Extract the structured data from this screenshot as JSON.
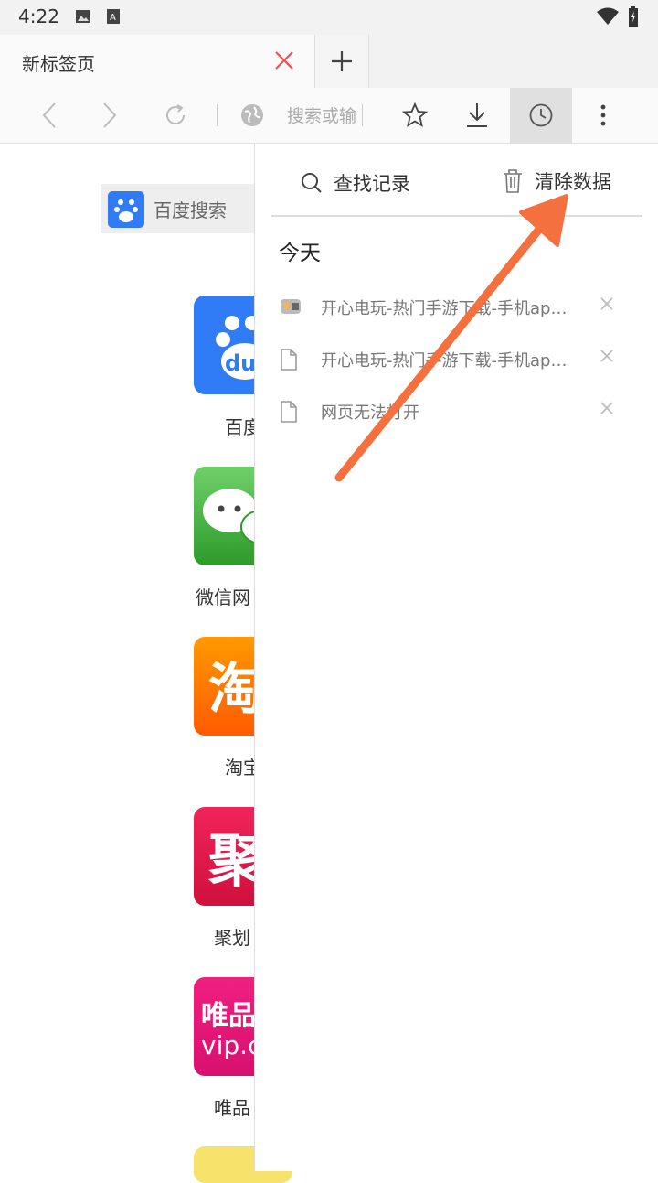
{
  "status": {
    "time": "4:22"
  },
  "tab": {
    "title": "新标签页"
  },
  "toolbar": {
    "url_placeholder": "搜索或输"
  },
  "home": {
    "search_label": "百度搜索",
    "apps": [
      {
        "label": "百度",
        "color": "#2f7cf6"
      },
      {
        "label": "微信网",
        "color": "#4caf50"
      },
      {
        "label": "淘宝",
        "color": "#ff6a00"
      },
      {
        "label": "聚划",
        "color": "#e3174d"
      },
      {
        "label": "唯品",
        "color": "#e6137e"
      }
    ]
  },
  "history_panel": {
    "search_label": "查找记录",
    "clear_label": "清除数据",
    "section": "今天",
    "items": [
      {
        "title": "开心电玩-热门手游下载-手机app下载",
        "icon": "site-favicon-icon"
      },
      {
        "title": "开心电玩-热门手游下载-手机app下载",
        "icon": "document-icon"
      },
      {
        "title": "网页无法打开",
        "icon": "document-icon"
      }
    ]
  },
  "colors": {
    "accent_arrow": "#f4703f",
    "close_red": "#f05050"
  }
}
